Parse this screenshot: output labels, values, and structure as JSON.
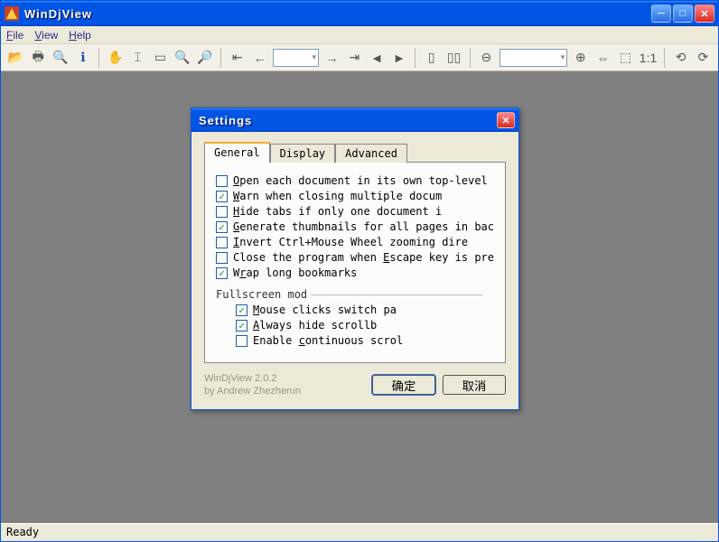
{
  "app_title": "WinDjView",
  "menu": {
    "file": "File",
    "view": "View",
    "help": "Help"
  },
  "status": "Ready",
  "dialog": {
    "title": "Settings",
    "tabs": {
      "general": "General",
      "display": "Display",
      "advanced": "Advanced"
    },
    "options": [
      {
        "checked": false,
        "label": "Open each document in its own top-level w"
      },
      {
        "checked": true,
        "label": "Warn when closing multiple docum"
      },
      {
        "checked": false,
        "label": "Hide tabs if only one document i"
      },
      {
        "checked": true,
        "label": "Generate thumbnails for all pages in bacl"
      },
      {
        "checked": false,
        "label": "Invert Ctrl+Mouse Wheel zooming dire"
      },
      {
        "checked": false,
        "label": "Close the program when Escape key is pre"
      },
      {
        "checked": true,
        "label": "Wrap long bookmarks"
      }
    ],
    "fullscreen_label": "Fullscreen mod",
    "fullscreen_options": [
      {
        "checked": true,
        "label": "Mouse clicks switch pa"
      },
      {
        "checked": true,
        "label": "Always hide scrollb"
      },
      {
        "checked": false,
        "label": "Enable continuous scrol"
      }
    ],
    "credits_line1": "WinDjView 2.0.2",
    "credits_line2": "by Andrew Zhezherun",
    "ok": "确定",
    "cancel": "取消"
  }
}
